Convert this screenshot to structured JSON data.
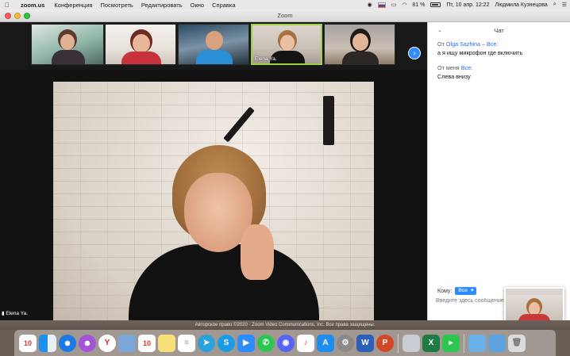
{
  "menubar": {
    "app": "zoom.us",
    "items": [
      "Конференция",
      "Посмотреть",
      "Редактировать",
      "Окно",
      "Справка"
    ],
    "battery": "81 %",
    "datetime": "Пт, 10 апр.  12:22",
    "user": "Людмила Кузнецова"
  },
  "window": {
    "title": "Zoom"
  },
  "gallery": {
    "thumbs": [
      {
        "name": ""
      },
      {
        "name": ""
      },
      {
        "name": ""
      },
      {
        "name": "Elena Ya."
      },
      {
        "name": ""
      }
    ]
  },
  "main_video": {
    "name": "Elena Ya."
  },
  "chat": {
    "title": "Чат",
    "messages": [
      {
        "from_prefix": "От",
        "sender": "Olga Sazhina",
        "to": "Все",
        "text": "а я ищу микрофон где включить"
      },
      {
        "from_prefix": "От",
        "sender": "меня",
        "to": "Все",
        "text": "Слева внизу"
      }
    ],
    "to_label": "Кому:",
    "to_value": "Все",
    "placeholder": "Введите здесь сообщение..."
  },
  "footer": {
    "copyright": "Авторское право ©2020 · Zoom Video Communications, Inc. Все права защищены."
  },
  "dock": {
    "calendar_date_1": "10",
    "calendar_date_2": "10",
    "icons": [
      "finder-icon",
      "safari-icon",
      "compass-icon",
      "yandex-icon",
      "preview-icon",
      "calendar-icon",
      "notes-icon",
      "reminders-icon",
      "telegram-icon",
      "skype-icon",
      "zoom-icon",
      "whatsapp-icon",
      "discord-icon",
      "music-icon",
      "appstore-icon",
      "settings-icon",
      "word-icon",
      "powerpoint-icon",
      "scanner-icon",
      "excel-icon",
      "facetime-icon",
      "folder-icon",
      "downloads-icon",
      "trash-icon"
    ]
  }
}
